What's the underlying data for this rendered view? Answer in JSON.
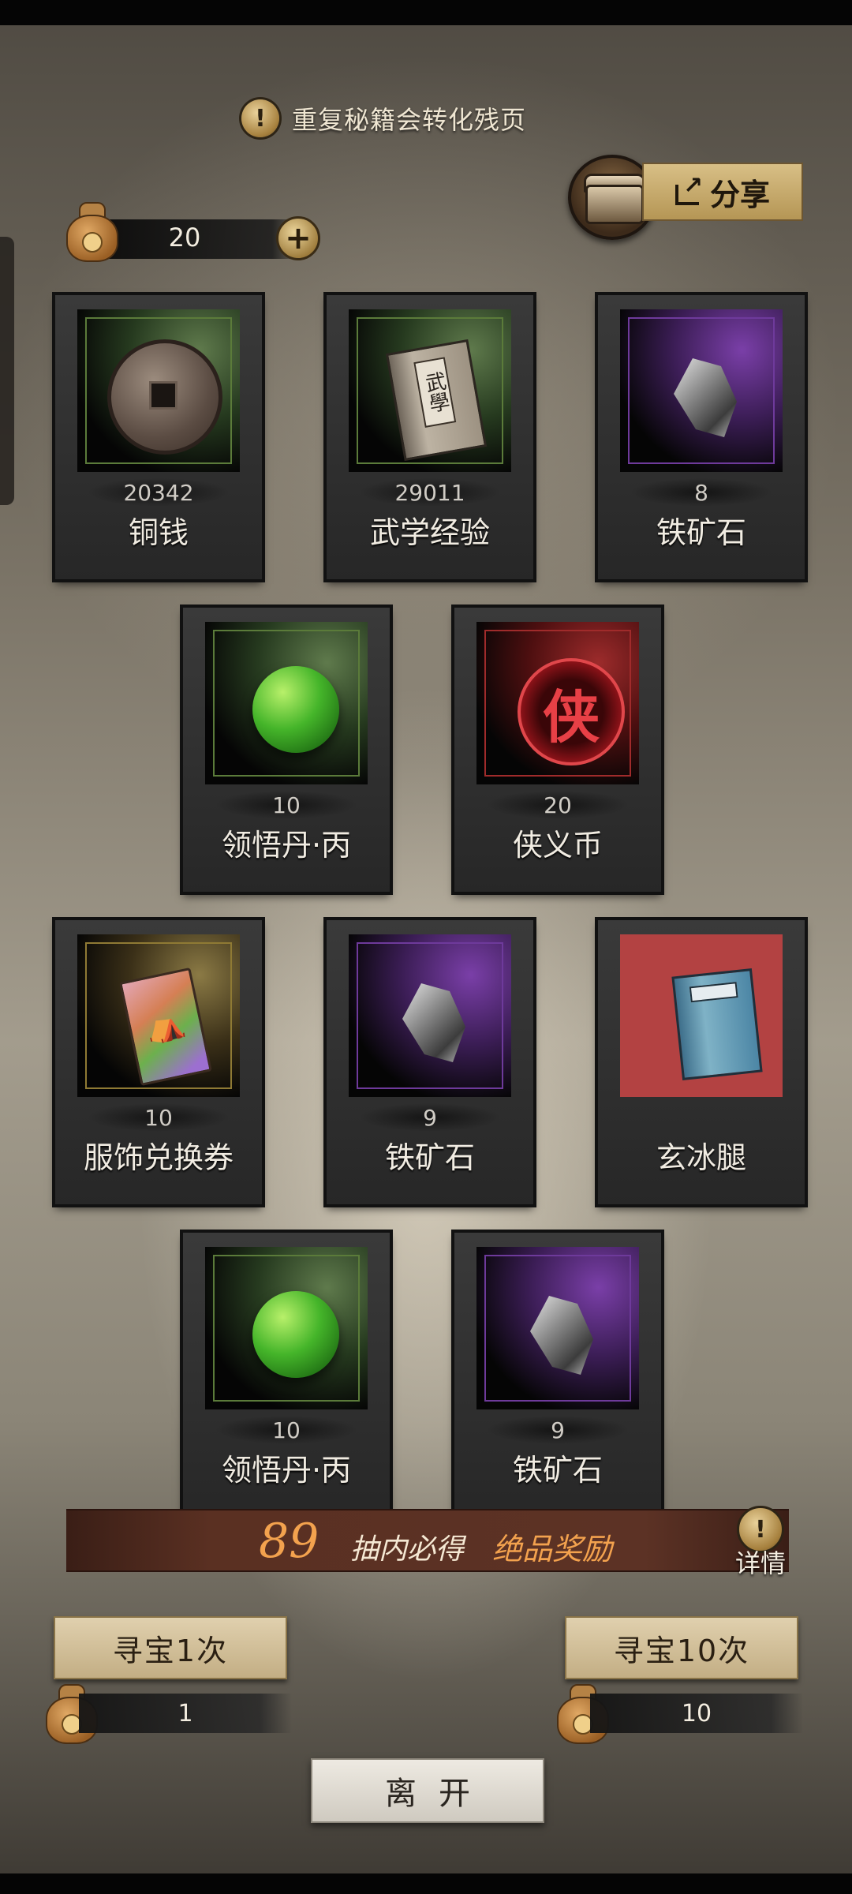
{
  "notice": {
    "icon": "exclamation-icon",
    "text": "重复秘籍会转化残页"
  },
  "share": {
    "label": "分享",
    "icon": "share-icon"
  },
  "currency": {
    "icon": "money-bag-icon",
    "value": "20"
  },
  "items": [
    {
      "count": "20342",
      "name": "铜钱",
      "rarity": "green",
      "icon": "copper-coin-icon"
    },
    {
      "count": "29011",
      "name": "武学经验",
      "rarity": "green",
      "icon": "martial-book-icon"
    },
    {
      "count": "8",
      "name": "铁矿石",
      "rarity": "purple",
      "icon": "iron-ore-icon"
    },
    {
      "count": "10",
      "name": "领悟丹·丙",
      "rarity": "green",
      "icon": "green-pill-icon"
    },
    {
      "count": "20",
      "name": "侠义币",
      "rarity": "red",
      "icon": "chivalry-token-icon"
    },
    {
      "count": "10",
      "name": "服饰兑换券",
      "rarity": "orange",
      "icon": "outfit-ticket-icon"
    },
    {
      "count": "9",
      "name": "铁矿石",
      "rarity": "purple",
      "icon": "iron-ore-icon"
    },
    {
      "count": "",
      "name": "玄冰腿",
      "rarity": "red",
      "icon": "skill-manual-icon"
    },
    {
      "count": "10",
      "name": "领悟丹·丙",
      "rarity": "green",
      "icon": "green-pill-icon"
    },
    {
      "count": "9",
      "name": "铁矿石",
      "rarity": "purple",
      "icon": "iron-ore-icon"
    }
  ],
  "guarantee": {
    "number": "89",
    "text": "抽内必得",
    "reward": "绝品奖励"
  },
  "details": {
    "label": "详情"
  },
  "draw_once": {
    "label": "寻宝1次",
    "cost": "1"
  },
  "draw_ten": {
    "label": "寻宝10次",
    "cost": "10"
  },
  "leave": {
    "label": "离开"
  },
  "colors": {
    "accent_gold": "#d8bf86",
    "guarantee_orange": "#f3a24e",
    "banner_bg": "#5a3022"
  }
}
